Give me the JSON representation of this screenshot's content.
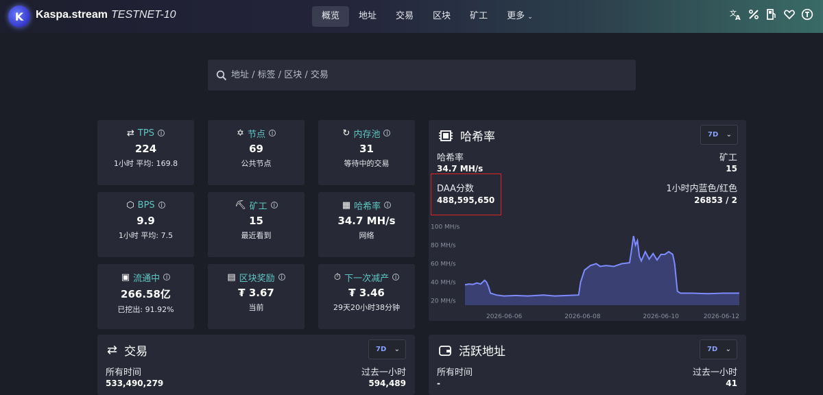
{
  "nav": {
    "brand": "Kaspa.stream",
    "network": "TESTNET-10",
    "items": [
      "概览",
      "地址",
      "交易",
      "区块",
      "矿工",
      "更多"
    ],
    "active_index": 0,
    "right_icons": [
      "translate-icon",
      "percent-icon",
      "fuel-icon",
      "heart-icon",
      "token-icon"
    ]
  },
  "search": {
    "placeholder": "地址 / 标签 / 区块 / 交易"
  },
  "cards": [
    {
      "icon": "arrows-icon",
      "label": "TPS",
      "value": "224",
      "sub": "1小时 平均: 169.8"
    },
    {
      "icon": "network-icon",
      "label": "节点",
      "value": "69",
      "sub": "公共节点"
    },
    {
      "icon": "refresh-icon",
      "label": "内存池",
      "value": "31",
      "sub": "等待中的交易"
    },
    {
      "icon": "cube-icon",
      "label": "BPS",
      "value": "9.9",
      "sub": "1小时 平均: 7.5"
    },
    {
      "icon": "pickaxe-icon",
      "label": "矿工",
      "value": "15",
      "sub": "最近看到"
    },
    {
      "icon": "chip-icon",
      "label": "哈希率",
      "value": "34.7 MH/s",
      "sub": "网络"
    },
    {
      "icon": "supply-icon",
      "label": "流通中",
      "value": "266.58亿",
      "sub": "已挖出: 91.92%"
    },
    {
      "icon": "reward-icon",
      "label": "区块奖励",
      "value": "₮ 3.67",
      "sub": "当前"
    },
    {
      "icon": "stopwatch-icon",
      "label": "下一次减产",
      "value": "₮ 3.46",
      "sub": "29天20小时38分钟"
    }
  ],
  "hashrate_panel": {
    "title": "哈希率",
    "range": "7D",
    "hashrate_label": "哈希率",
    "hashrate_value": "34.7 MH/s",
    "miners_label": "矿工",
    "miners_value": "15",
    "daa_label": "DAA分数",
    "daa_value": "488,595,650",
    "bluered_label": "1小时内蓝色/红色",
    "bluered_value": "26853 / 2"
  },
  "chart_data": {
    "type": "area",
    "y_ticks": [
      "100 MH/s",
      "80 MH/s",
      "60 MH/s",
      "40 MH/s",
      "20 MH/s"
    ],
    "x_ticks": [
      "2026-06-06",
      "2026-06-08",
      "2026-06-10",
      "2026-06-12"
    ],
    "ylim": [
      15,
      102
    ],
    "xlim": [
      0,
      7
    ],
    "series": [
      {
        "color": "#7d8bff",
        "points": [
          [
            0.0,
            37
          ],
          [
            0.1,
            38
          ],
          [
            0.2,
            37.5
          ],
          [
            0.3,
            39
          ],
          [
            0.4,
            38
          ],
          [
            0.5,
            42
          ],
          [
            0.55,
            40
          ],
          [
            0.6,
            35
          ],
          [
            0.65,
            28
          ],
          [
            0.8,
            26
          ],
          [
            1.0,
            25
          ],
          [
            1.3,
            25.5
          ],
          [
            1.6,
            25
          ],
          [
            2.0,
            26
          ],
          [
            2.3,
            25
          ],
          [
            2.6,
            25.5
          ],
          [
            2.9,
            26
          ],
          [
            2.95,
            40
          ],
          [
            3.05,
            53
          ],
          [
            3.2,
            58
          ],
          [
            3.35,
            60
          ],
          [
            3.45,
            57
          ],
          [
            3.6,
            58
          ],
          [
            3.8,
            57
          ],
          [
            4.0,
            60
          ],
          [
            4.2,
            61
          ],
          [
            4.25,
            75
          ],
          [
            4.3,
            90
          ],
          [
            4.35,
            80
          ],
          [
            4.4,
            85
          ],
          [
            4.45,
            68
          ],
          [
            4.5,
            63
          ],
          [
            4.6,
            73
          ],
          [
            4.7,
            65
          ],
          [
            4.8,
            71
          ],
          [
            4.9,
            64
          ],
          [
            5.0,
            70
          ],
          [
            5.1,
            70
          ],
          [
            5.2,
            73
          ],
          [
            5.3,
            70
          ],
          [
            5.35,
            60
          ],
          [
            5.42,
            30
          ],
          [
            5.5,
            28
          ],
          [
            5.8,
            28
          ],
          [
            6.2,
            27.5
          ],
          [
            6.6,
            28
          ],
          [
            7.0,
            28
          ]
        ]
      }
    ]
  },
  "tx_panel": {
    "title": "交易",
    "range": "7D",
    "left_label": "所有时间",
    "left_value": "533,490,279",
    "right_label": "过去一小时",
    "right_value": "594,489"
  },
  "addr_panel": {
    "title": "活跃地址",
    "range": "7D",
    "left_label": "所有时间",
    "left_value": "-",
    "right_label": "过去一小时",
    "right_value": "41"
  }
}
